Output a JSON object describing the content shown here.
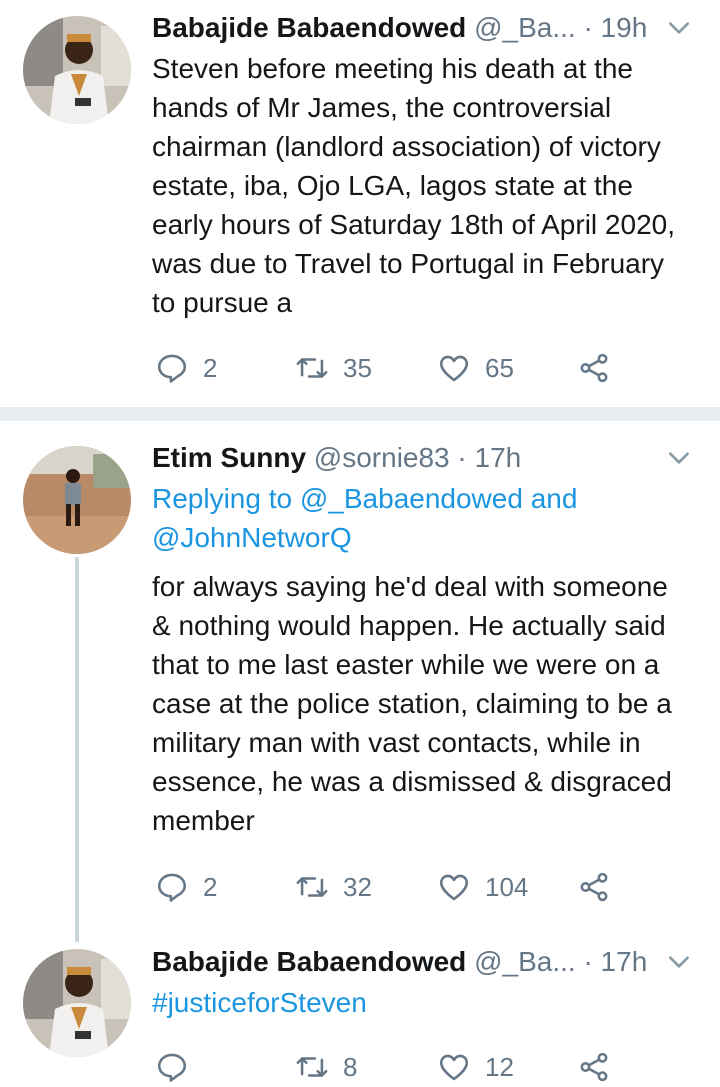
{
  "tweets": [
    {
      "name": "Babajide Babaendowed",
      "handle": "@_Ba...",
      "time": "· 19h",
      "text": "Steven before meeting his death at the hands of  Mr James, the controversial chairman (landlord association) of victory estate, iba, Ojo LGA, lagos state at the early hours of Saturday 18th of April 2020, was due to Travel to Portugal in February to pursue a",
      "replies": "2",
      "retweets": "35",
      "likes": "65"
    },
    {
      "name": "Etim Sunny",
      "handle": "@sornie83",
      "time": "· 17h",
      "replying_prefix": "Replying to",
      "replying_users": "@_Babaendowed and @JohnNetworQ",
      "text": "for always saying he'd deal with someone & nothing would happen. He actually said that to me last easter while we were on a case at the police station, claiming to be a military man with vast contacts, while in essence, he was a dismissed & disgraced member",
      "replies": "2",
      "retweets": "32",
      "likes": "104"
    },
    {
      "name": "Babajide Babaendowed",
      "handle": "@_Ba...",
      "time": "· 17h",
      "hashtag": "#justiceforSteven",
      "replies": "",
      "retweets": "8",
      "likes": "12"
    }
  ],
  "colors": {
    "link": "#1b95e0",
    "muted": "#657786",
    "separator": "#e6ecf0",
    "text": "#14171a"
  },
  "icons": [
    "reply-icon",
    "retweet-icon",
    "like-icon",
    "share-icon",
    "chevron-down-icon"
  ]
}
